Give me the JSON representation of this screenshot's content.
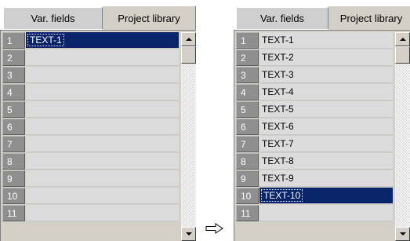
{
  "left_panel": {
    "tabs": [
      {
        "label": "Var. fields",
        "active": false
      },
      {
        "label": "Project library",
        "active": true
      }
    ],
    "rows": [
      {
        "num": "1",
        "text": "TEXT-1",
        "selected": true
      },
      {
        "num": "2",
        "text": "",
        "selected": false
      },
      {
        "num": "3",
        "text": "",
        "selected": false
      },
      {
        "num": "4",
        "text": "",
        "selected": false
      },
      {
        "num": "5",
        "text": "",
        "selected": false
      },
      {
        "num": "6",
        "text": "",
        "selected": false
      },
      {
        "num": "7",
        "text": "",
        "selected": false
      },
      {
        "num": "8",
        "text": "",
        "selected": false
      },
      {
        "num": "9",
        "text": "",
        "selected": false
      },
      {
        "num": "10",
        "text": "",
        "selected": false
      },
      {
        "num": "11",
        "text": "",
        "selected": false
      }
    ],
    "scroll_position": 0.0
  },
  "right_panel": {
    "tabs": [
      {
        "label": "Var. fields",
        "active": false
      },
      {
        "label": "Project library",
        "active": true
      }
    ],
    "rows": [
      {
        "num": "1",
        "text": "TEXT-1",
        "selected": false
      },
      {
        "num": "2",
        "text": "TEXT-2",
        "selected": false
      },
      {
        "num": "3",
        "text": "TEXT-3",
        "selected": false
      },
      {
        "num": "4",
        "text": "TEXT-4",
        "selected": false
      },
      {
        "num": "5",
        "text": "TEXT-5",
        "selected": false
      },
      {
        "num": "6",
        "text": "TEXT-6",
        "selected": false
      },
      {
        "num": "7",
        "text": "TEXT-7",
        "selected": false
      },
      {
        "num": "8",
        "text": "TEXT-8",
        "selected": false
      },
      {
        "num": "9",
        "text": "TEXT-9",
        "selected": false
      },
      {
        "num": "10",
        "text": "TEXT-10",
        "selected": true
      },
      {
        "num": "11",
        "text": "",
        "selected": false
      }
    ],
    "scroll_position": 0.0
  },
  "transition_icon": "right-arrow-outline-icon",
  "colors": {
    "selection_bg": "#0a246a",
    "selection_text": "#ffffff",
    "row_number_bg": "#8f8f8f",
    "cell_bg": "#dcdcdc",
    "tab_face": "#d4d0c8"
  }
}
